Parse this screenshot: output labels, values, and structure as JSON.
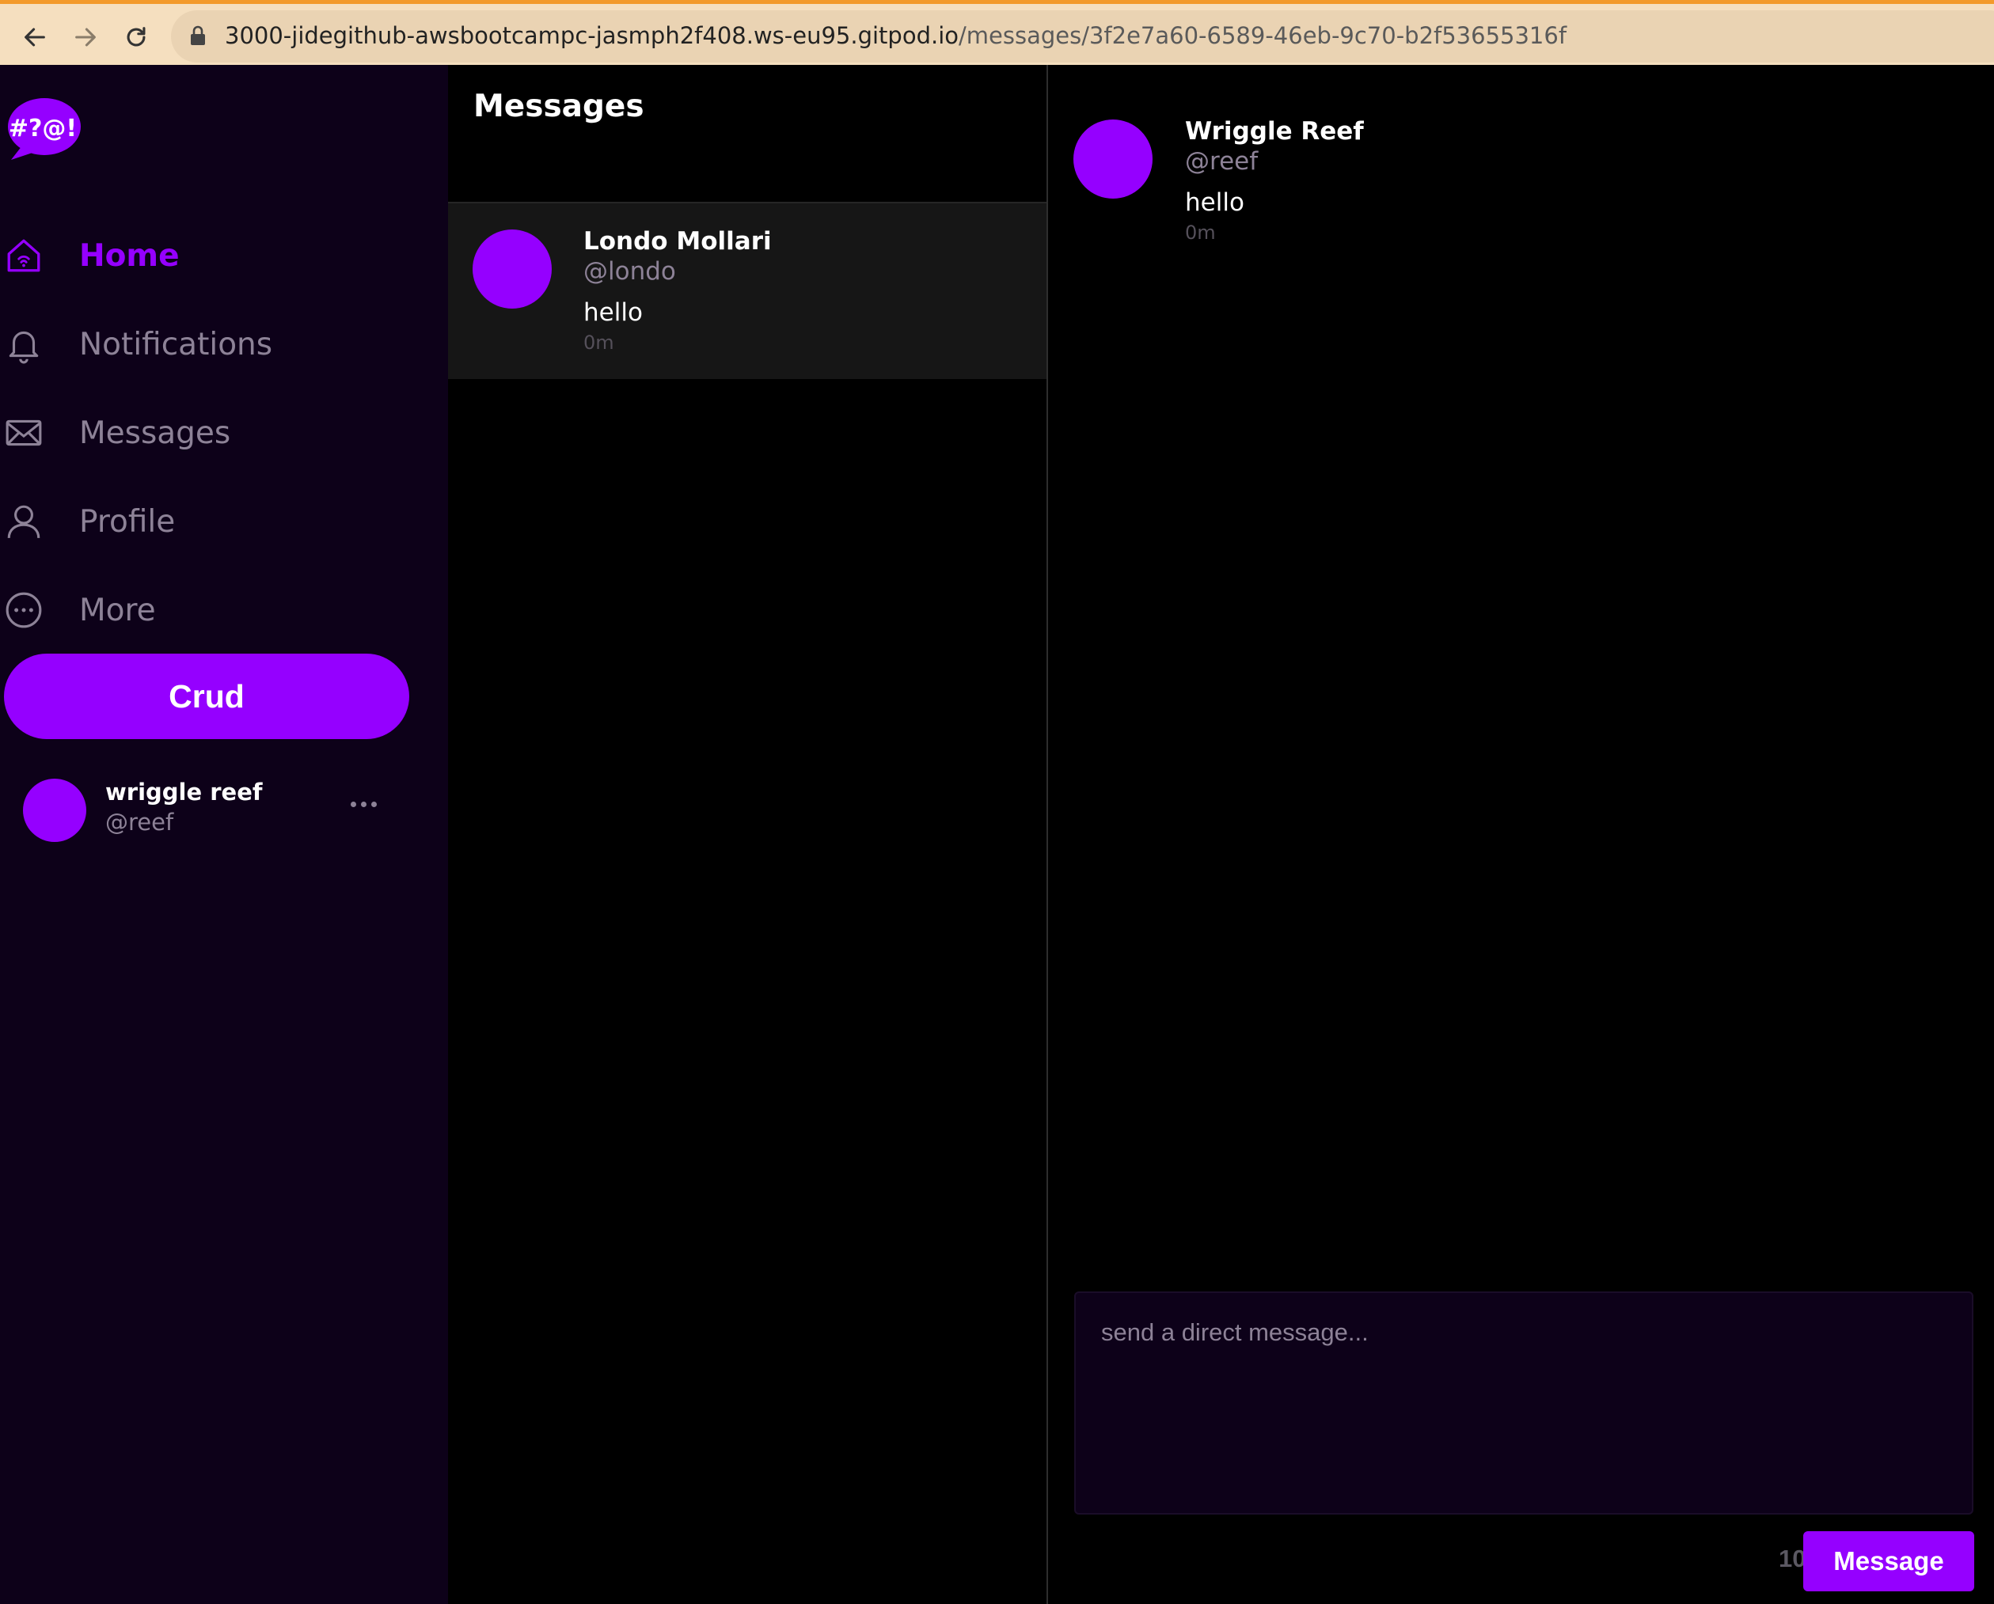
{
  "browser": {
    "url_host": "3000-jidegithub-awsbootcampc-jasmph2f408.ws-eu95.gitpod.io",
    "url_path": "/messages/3f2e7a60-6589-46eb-9c70-b2f53655316f"
  },
  "app": {
    "logo_text": "#?@!"
  },
  "sidebar": {
    "items": [
      {
        "label": "Home",
        "icon": "home-icon",
        "active": true
      },
      {
        "label": "Notifications",
        "icon": "bell-icon",
        "active": false
      },
      {
        "label": "Messages",
        "icon": "envelope-icon",
        "active": false
      },
      {
        "label": "Profile",
        "icon": "user-icon",
        "active": false
      },
      {
        "label": "More",
        "icon": "more-circle-icon",
        "active": false
      }
    ],
    "crud_label": "Crud",
    "profile": {
      "display_name": "wriggle reef",
      "handle": "@reef"
    }
  },
  "groups": {
    "title": "Messages",
    "items": [
      {
        "display_name": "Londo Mollari",
        "handle": "@londo",
        "message": "hello",
        "time": "0m"
      }
    ]
  },
  "conversation": {
    "messages": [
      {
        "display_name": "Wriggle Reef",
        "handle": "@reef",
        "message": "hello",
        "time": "0m"
      }
    ],
    "composer": {
      "placeholder": "send a direct message...",
      "count": "1024",
      "submit_label": "Message"
    }
  },
  "colors": {
    "accent": "#9500ff",
    "sidebar_bg": "#0d0119",
    "muted_text": "#8d8297",
    "browser_bar": "#f5dfbf"
  }
}
